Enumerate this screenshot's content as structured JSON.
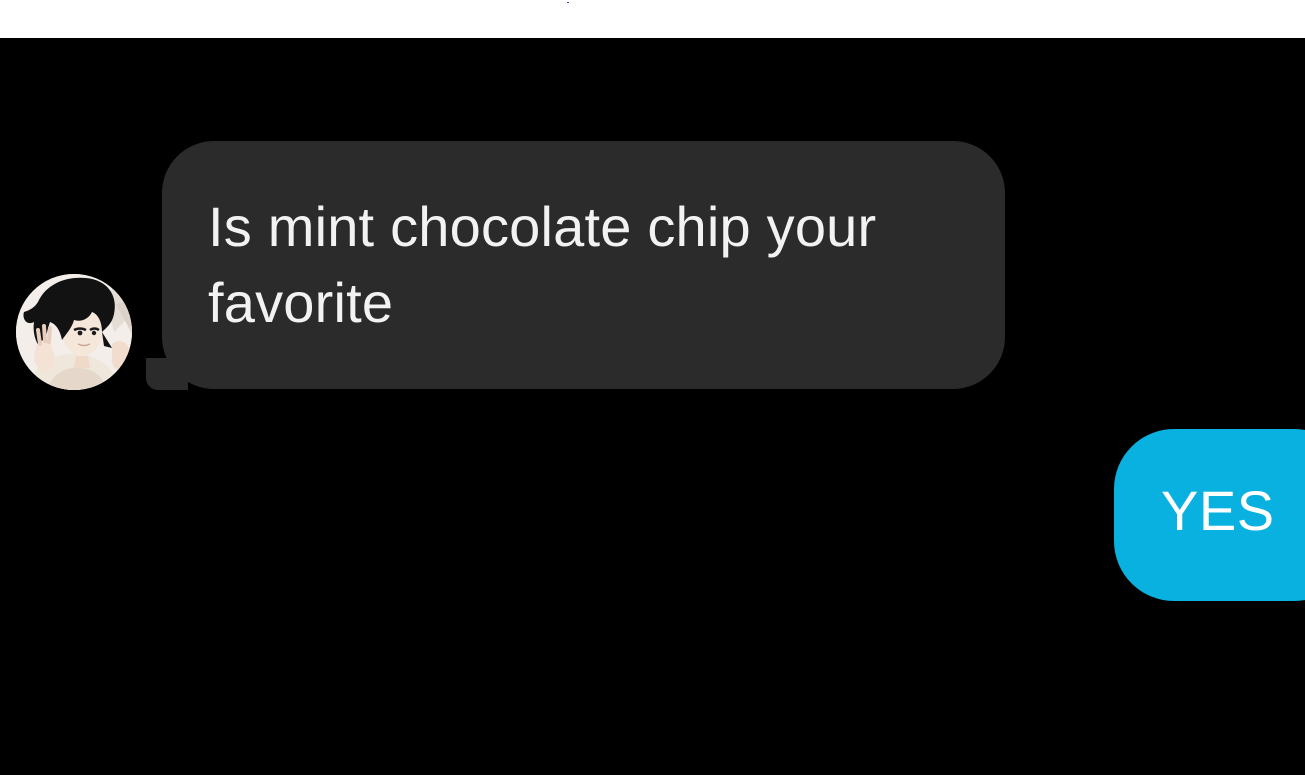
{
  "conversation": {
    "incoming_message": {
      "text": "Is mint chocolate chip your\nfavorite",
      "avatar_icon": "anime-character-avatar-icon"
    },
    "outgoing_message": {
      "text": "YES"
    }
  },
  "colors": {
    "background": "#000000",
    "top_strip": "#ffffff",
    "incoming_bubble": "#2b2b2b",
    "incoming_text": "#f2f2f2",
    "outgoing_bubble": "#08b1df",
    "outgoing_text": "#ffffff"
  }
}
